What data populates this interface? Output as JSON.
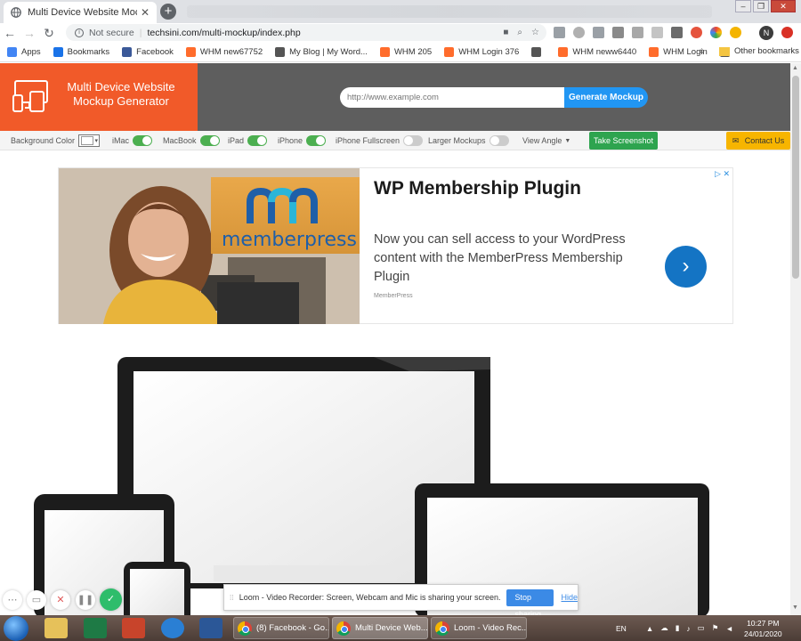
{
  "browser": {
    "tab_title": "Multi Device Website Mockup Ge",
    "new_tab_label": "+",
    "not_secure": "Not secure",
    "url": "techsini.com/multi-mockup/index.php",
    "profile_initial": "N"
  },
  "bookmarks": {
    "items": [
      {
        "label": "Apps",
        "icon": "apps-grid-icon",
        "color": "#4285f4"
      },
      {
        "label": "Bookmarks",
        "icon": "star-icon",
        "color": "#1a73e8"
      },
      {
        "label": "Facebook",
        "icon": "facebook-icon",
        "color": "#3b5998"
      },
      {
        "label": "WHM new67752",
        "icon": "cpanel-icon",
        "color": "#ff6c2c"
      },
      {
        "label": "My Blog | My Word...",
        "icon": "wordpress-icon",
        "color": "#555555"
      },
      {
        "label": "WHM 205",
        "icon": "cpanel-icon",
        "color": "#ff6c2c"
      },
      {
        "label": "WHM Login 376",
        "icon": "cpanel-icon",
        "color": "#ff6c2c"
      },
      {
        "label": "",
        "icon": "wordpress-icon",
        "color": "#555555"
      },
      {
        "label": "WHM neww6440",
        "icon": "cpanel-icon",
        "color": "#ff6c2c"
      },
      {
        "label": "WHM Login",
        "icon": "cpanel-icon",
        "color": "#ff6c2c"
      },
      {
        "label": "",
        "icon": "wordpress-icon",
        "color": "#555555"
      }
    ],
    "more": "»",
    "other": "Other bookmarks"
  },
  "site": {
    "logo_line1": "Multi Device Website",
    "logo_line2": "Mockup Generator",
    "url_placeholder": "http://www.example.com",
    "generate_button": "Generate Mockup",
    "brand_color": "#f15a29",
    "header_color": "#5e5e5e"
  },
  "options": {
    "background_color": "Background Color",
    "toggles": [
      {
        "label": "iMac",
        "on": true
      },
      {
        "label": "MacBook",
        "on": true
      },
      {
        "label": "iPad",
        "on": true
      },
      {
        "label": "iPhone",
        "on": true
      },
      {
        "label": "iPhone Fullscreen",
        "on": false
      },
      {
        "label": "Larger Mockups",
        "on": false
      }
    ],
    "view_angle": "View Angle",
    "take_screenshot": "Take Screenshot",
    "contact_us": "Contact Us"
  },
  "ad": {
    "brand": "memberpress",
    "title": "WP Membership Plugin",
    "description": "Now you can sell access to your WordPress content with the MemberPress Membership Plugin",
    "source": "MemberPress",
    "choices_icon": "ad-choices-icon"
  },
  "loom": {
    "message": "Loom - Video Recorder: Screen, Webcam and Mic is sharing your screen.",
    "stop_sharing": "Stop sharing",
    "hide": "Hide",
    "controls": [
      "more-icon",
      "camera-icon",
      "cancel-icon",
      "pause-icon",
      "done-icon"
    ]
  },
  "taskbar": {
    "tasks": [
      {
        "label": "(8) Facebook - Go...",
        "active": false
      },
      {
        "label": "Multi Device Web...",
        "active": true
      },
      {
        "label": "Loom - Video Rec...",
        "active": false
      }
    ],
    "language": "EN",
    "time": "10:27 PM",
    "date": "24/01/2020"
  }
}
